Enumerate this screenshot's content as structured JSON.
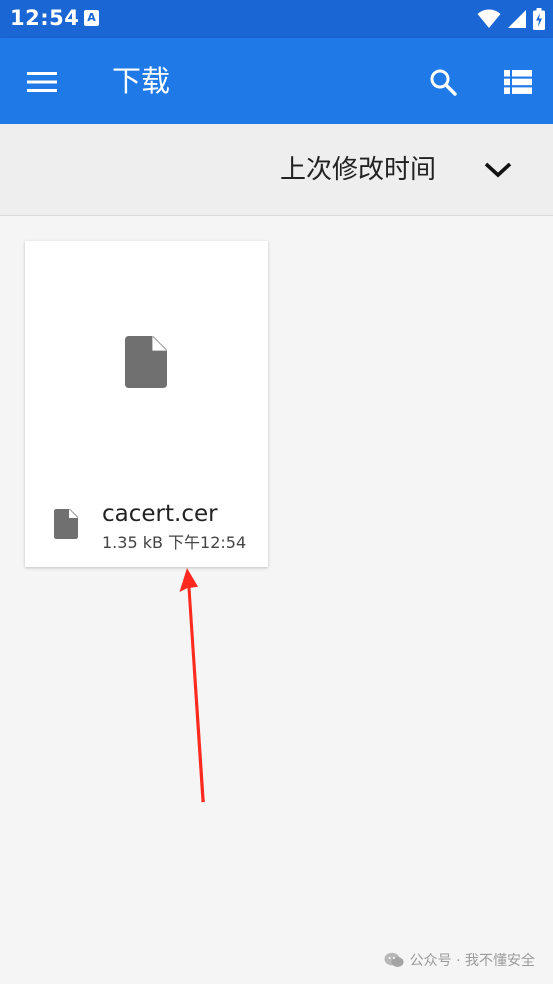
{
  "status_bar": {
    "time": "12:54",
    "app_notification_icon": "keyboard-a-icon",
    "icons": [
      "wifi-icon",
      "signal-icon",
      "battery-charging-icon"
    ]
  },
  "app_bar": {
    "menu_icon": "menu-icon",
    "title": "下载",
    "search_icon": "search-icon",
    "view_toggle_icon": "list-view-icon"
  },
  "sort_bar": {
    "label": "上次修改时间",
    "toggle_icon": "chevron-down-icon"
  },
  "files": [
    {
      "name": "cacert.cer",
      "meta": "1.35 kB  下午12:54",
      "icon": "file-icon"
    }
  ],
  "annotation": {
    "color": "#ff2a1f",
    "icon": "red-arrow"
  },
  "watermark": {
    "text": "公众号 · 我不懂安全",
    "icon": "wechat-icon"
  },
  "colors": {
    "status_bar": "#1a66d4",
    "app_bar": "#1f7ae8",
    "background": "#f5f5f5"
  }
}
